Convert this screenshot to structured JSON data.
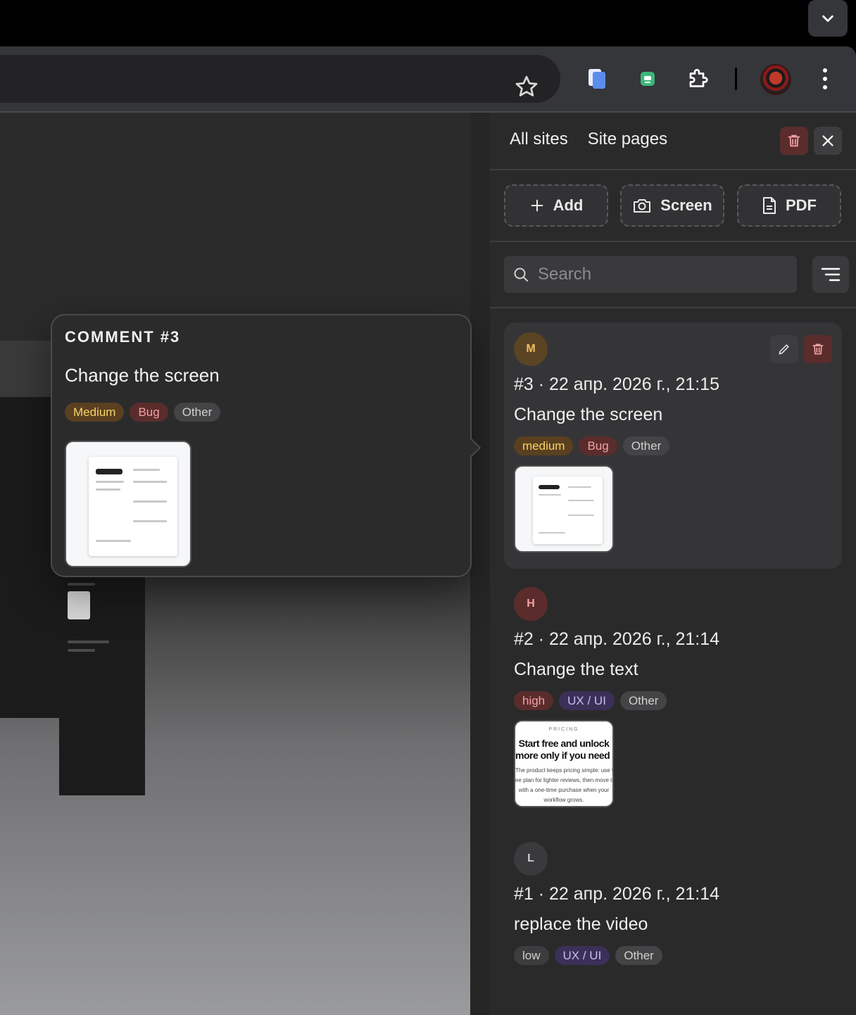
{
  "browser": {
    "tab_dropdown_icon": "chevron-down-icon",
    "extensions": [
      "clipboard-extension-icon",
      "chat-extension-icon",
      "puzzle-extensions-icon"
    ],
    "profile_icon": "profile-avatar",
    "menu_icon": "kebab-menu-icon"
  },
  "popover": {
    "label": "COMMENT #3",
    "text": "Change the screen",
    "tags": [
      "Medium",
      "Bug",
      "Other"
    ]
  },
  "panel": {
    "tabs": [
      "All sites",
      "Site pages"
    ],
    "actions": {
      "add": "Add",
      "screen": "Screen",
      "pdf": "PDF"
    },
    "search_placeholder": "Search",
    "comments": [
      {
        "initial": "M",
        "avatar_color": "#5a4424",
        "initial_color": "#f0c060",
        "meta": "#3 · 22 апр. 2026 г., 21:15",
        "text": "Change the screen",
        "tags": [
          "medium",
          "Bug",
          "Other"
        ]
      },
      {
        "initial": "H",
        "avatar_color": "#5b2c2c",
        "initial_color": "#f0a3a3",
        "meta": "#2 · 22 апр. 2026 г., 21:14",
        "text": "Change the text",
        "tags": [
          "high",
          "UX / UI",
          "Other"
        ],
        "thumb": {
          "label": "PRICING",
          "title_1": "Start free and unlock",
          "title_2": "more only if you need i",
          "body_1": "The product keeps pricing simple: use th",
          "body_2": "ee plan for lighter reviews, then move to",
          "body_3": "with a one-time purchase when your",
          "body_4": "workflow grows."
        }
      },
      {
        "initial": "L",
        "avatar_color": "#3a3a3c",
        "initial_color": "#d0d0d0",
        "meta": "#1 · 22 апр. 2026 г., 21:14",
        "text": "replace the video",
        "tags": [
          "low",
          "UX / UI",
          "Other"
        ]
      }
    ]
  },
  "colors": {
    "panel_bg": "#2a2a2b",
    "delete_bg": "#5b2c2c",
    "tag_medium": "#f5d466",
    "tag_bug": "#f0a3a3",
    "tag_uxui": "#c8bcf0"
  }
}
